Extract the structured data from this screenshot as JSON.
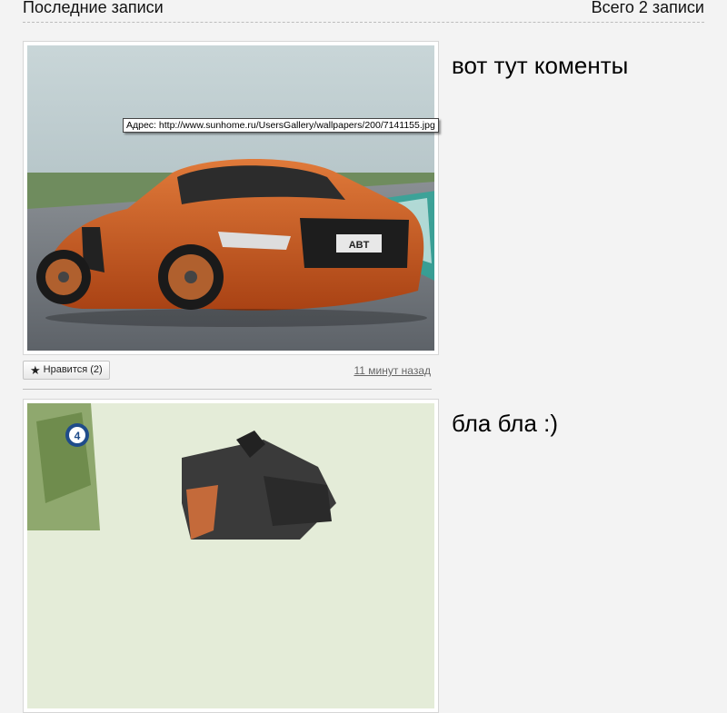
{
  "header": {
    "title": "Последние записи",
    "count": "Всего 2 записи"
  },
  "posts": [
    {
      "text": "вот тут коменты",
      "like_label": "Нравится (2)",
      "time": "11 минут назад",
      "image": "orange-sports-car-photo"
    },
    {
      "text": "бла бла :)",
      "image": "motorcycle-stunt-photo"
    }
  ],
  "tooltip": {
    "text": "Адрес: http://www.sunhome.ru/UsersGallery/wallpapers/200/7141155.jpg"
  },
  "colors": {
    "background": "#f3f3f3",
    "car_body": "#c85a22"
  }
}
